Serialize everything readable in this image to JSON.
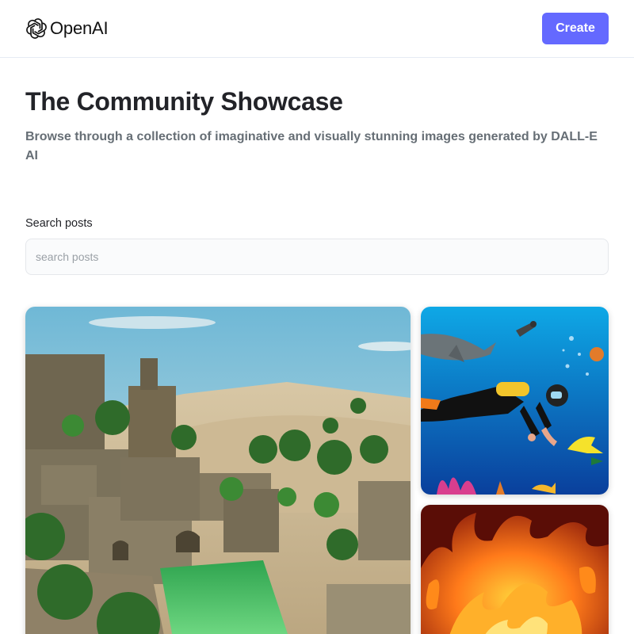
{
  "header": {
    "logo_text": "OpenAI",
    "create_label": "Create"
  },
  "hero": {
    "title": "The Community Showcase",
    "subtitle": "Browse through a collection of imaginative and visually stunning images generated by DALL-E AI"
  },
  "search": {
    "label": "Search posts",
    "placeholder": "search posts",
    "value": ""
  },
  "gallery": {
    "posts": [
      {
        "subject": "desert ruins with palm trees and green pool"
      },
      {
        "subject": "scuba diver underwater with fish"
      },
      {
        "subject": "flames"
      }
    ]
  },
  "colors": {
    "accent": "#6469ff",
    "title": "#222328",
    "subtitle": "#666e75"
  }
}
